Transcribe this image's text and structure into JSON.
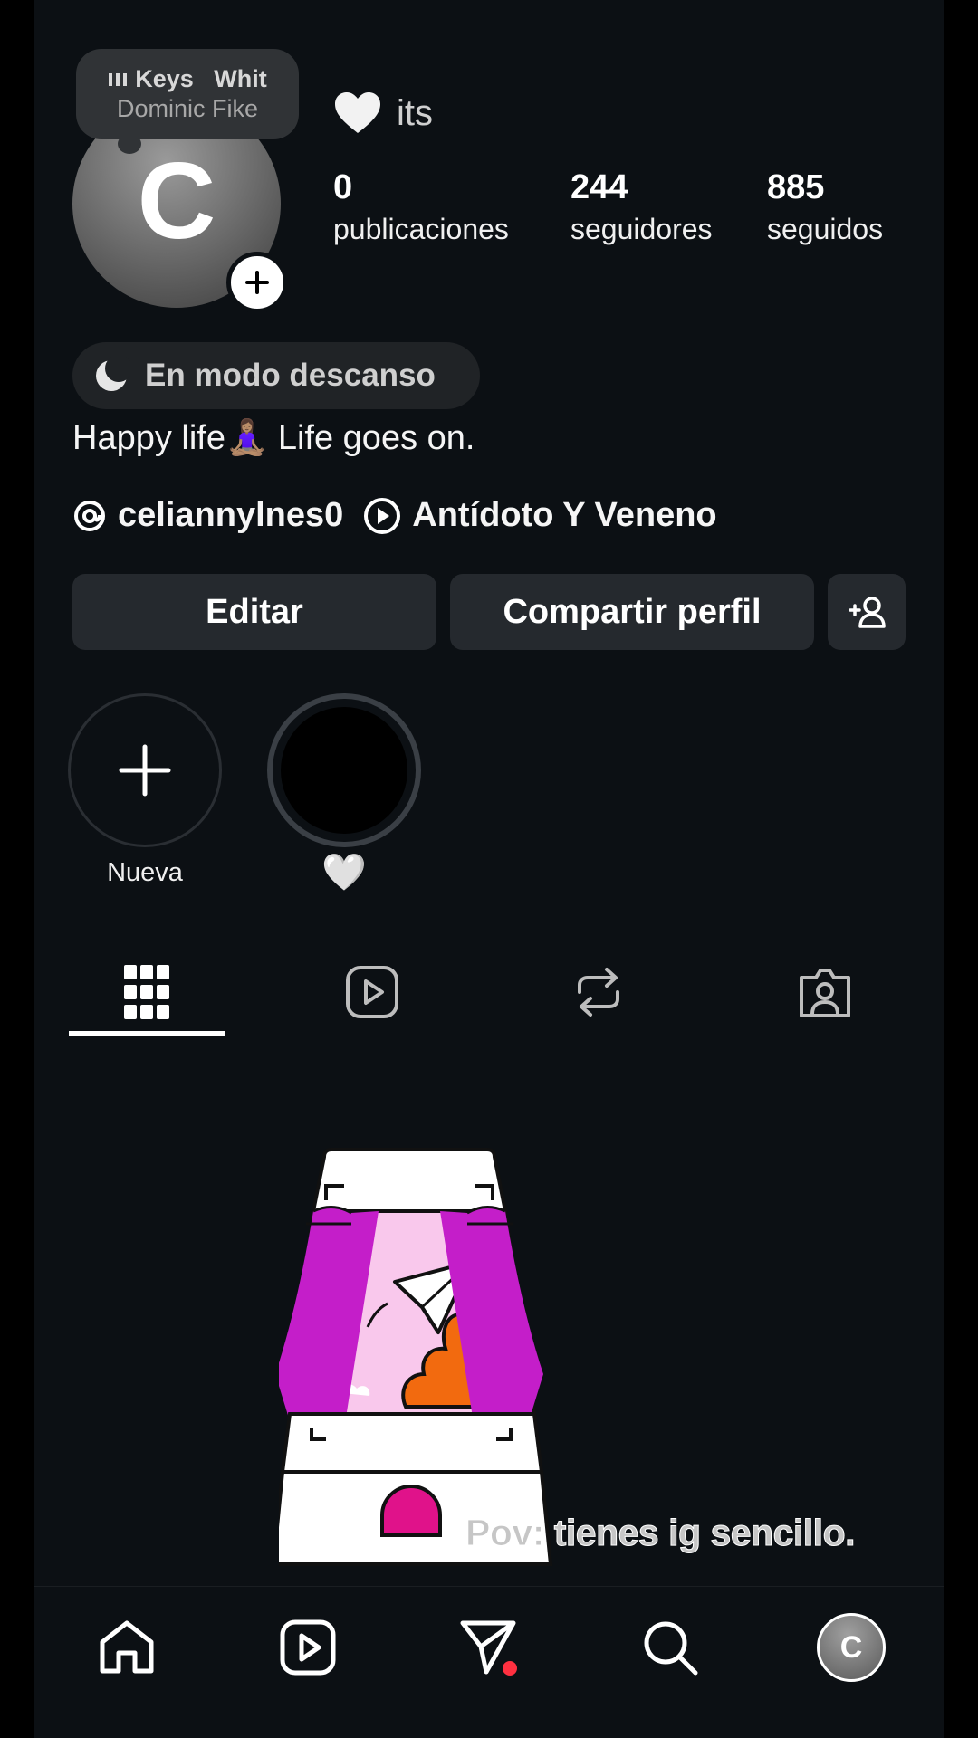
{
  "profile": {
    "avatar_letter": "C",
    "name": "its",
    "stats": [
      {
        "value": "0",
        "label": "publicaciones"
      },
      {
        "value": "244",
        "label": "seguidores"
      },
      {
        "value": "885",
        "label": "seguidos"
      }
    ],
    "status": "En modo descanso",
    "bio": "Happy life🧘🏽‍♀️ Life goes on.",
    "threads_handle": "celiannylnes0",
    "music_track": "Antídoto Y Veneno"
  },
  "note": {
    "song": "Keys   Whit",
    "artist": "Dominic Fike"
  },
  "actions": {
    "edit": "Editar",
    "share": "Compartir perfil"
  },
  "highlights": {
    "new_label": "Nueva",
    "heart_label": "🤍"
  },
  "tabs": [
    "grid",
    "reels",
    "reposts",
    "tagged"
  ],
  "overlay_text": "Pov: tienes ig sencillo.",
  "bottom_nav": {
    "profile_letter": "C",
    "items": [
      "home",
      "reels",
      "messages",
      "search",
      "profile"
    ]
  },
  "colors": {
    "background": "#0c1014",
    "button_bg": "#25292e",
    "accent_red": "#ff3040",
    "illustration_magenta": "#c41ec9",
    "illustration_orange": "#f26a0f",
    "illustration_pink": "#f9c8ec"
  }
}
